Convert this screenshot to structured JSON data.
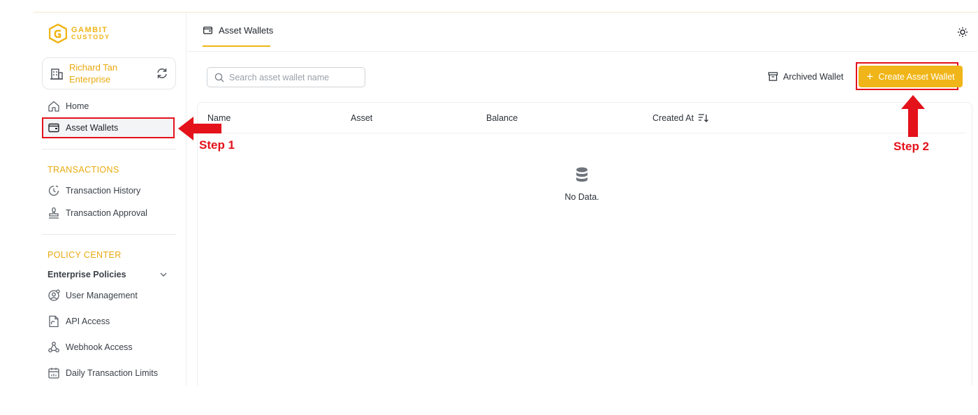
{
  "logo": {
    "line1": "GAMBIT",
    "line2": "CUSTODY"
  },
  "enterprise": {
    "name": "Richard Tan Enterprise"
  },
  "nav": {
    "home": "Home",
    "asset_wallets": "Asset Wallets",
    "transactions_title": "TRANSACTIONS",
    "transaction_history": "Transaction History",
    "transaction_approval": "Transaction Approval",
    "policy_center_title": "POLICY CENTER",
    "enterprise_policies": "Enterprise Policies",
    "user_management": "User Management",
    "api_access": "API Access",
    "webhook_access": "Webhook Access",
    "daily_transaction_limits": "Daily Transaction Limits"
  },
  "header": {
    "tab_label": "Asset Wallets"
  },
  "toolbar": {
    "search_placeholder": "Search asset wallet name",
    "archived_label": "Archived Wallet",
    "create_label": "Create Asset Wallet"
  },
  "table": {
    "columns": [
      "Name",
      "Asset",
      "Balance",
      "Created At"
    ],
    "empty_text": "No Data."
  },
  "annotations": {
    "step1": "Step 1",
    "step2": "Step 2"
  },
  "colors": {
    "brand": "#f0b518",
    "annotation": "#e3121b"
  }
}
